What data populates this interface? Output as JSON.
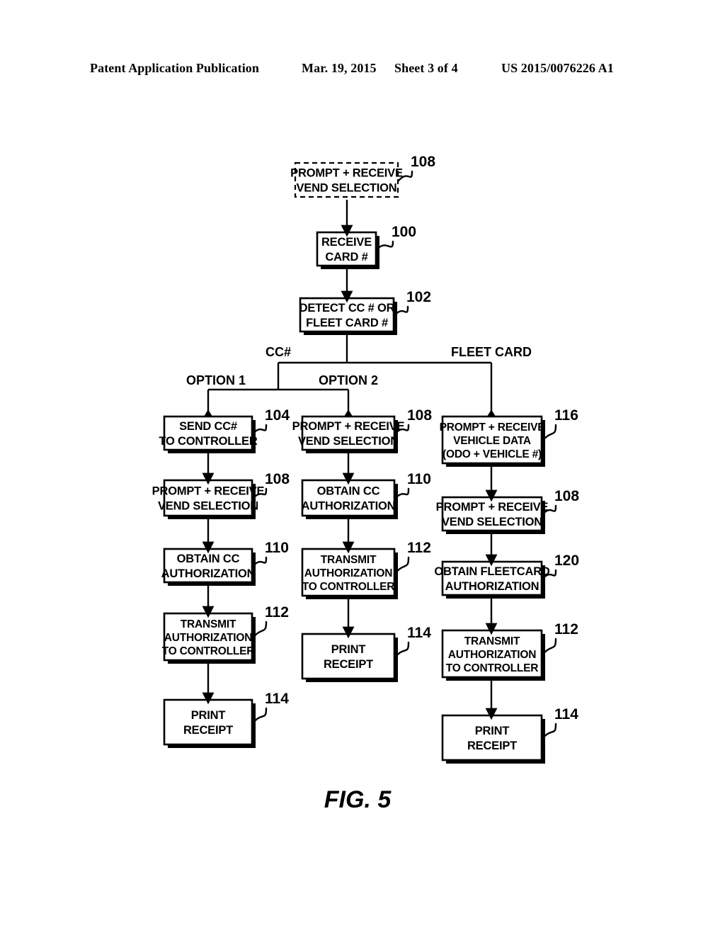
{
  "header": {
    "publication": "Patent Application Publication",
    "date": "Mar. 19, 2015",
    "sheet": "Sheet 3 of 4",
    "patent_number": "US 2015/0076226 A1"
  },
  "figure": {
    "caption": "FIG. 5",
    "caption_label": "FIG.",
    "caption_number": "5"
  },
  "branch_labels": {
    "cc": "CC#",
    "fleet_card": "FLEET CARD",
    "option1": "OPTION 1",
    "option2": "OPTION 2"
  },
  "nodes": {
    "start": {
      "lines": [
        "PROMPT + RECEIVE",
        "VEND SELECTION"
      ],
      "ref": "108",
      "style": "dashed"
    },
    "receive_card": {
      "lines": [
        "RECEIVE",
        "CARD #"
      ],
      "ref": "100",
      "style": "solid"
    },
    "detect": {
      "lines": [
        "DETECT CC # OR",
        "FLEET CARD #"
      ],
      "ref": "102",
      "style": "solid"
    },
    "col1": [
      {
        "lines": [
          "SEND CC#",
          "TO CONTROLLER"
        ],
        "ref": "104"
      },
      {
        "lines": [
          "PROMPT + RECEIVE",
          "VEND SELECTION"
        ],
        "ref": "108"
      },
      {
        "lines": [
          "OBTAIN CC",
          "AUTHORIZATION"
        ],
        "ref": "110"
      },
      {
        "lines": [
          "TRANSMIT",
          "AUTHORIZATION",
          "TO CONTROLLER"
        ],
        "ref": "112"
      },
      {
        "lines": [
          "PRINT",
          "RECEIPT"
        ],
        "ref": "114"
      }
    ],
    "col2": [
      {
        "lines": [
          "PROMPT + RECEIVE",
          "VEND SELECTION"
        ],
        "ref": "108"
      },
      {
        "lines": [
          "OBTAIN CC",
          "AUTHORIZATION"
        ],
        "ref": "110"
      },
      {
        "lines": [
          "TRANSMIT",
          "AUTHORIZATION",
          "TO CONTROLLER"
        ],
        "ref": "112"
      },
      {
        "lines": [
          "PRINT",
          "RECEIPT"
        ],
        "ref": "114"
      }
    ],
    "col3": [
      {
        "lines": [
          "PROMPT + RECEIVE",
          "VEHICLE DATA",
          "(ODO + VEHICLE #)"
        ],
        "ref": "116"
      },
      {
        "lines": [
          "PROMPT + RECEIVE",
          "VEND SELECTION"
        ],
        "ref": "108"
      },
      {
        "lines": [
          "OBTAIN FLEETCARD",
          "AUTHORIZATION"
        ],
        "ref": "120"
      },
      {
        "lines": [
          "TRANSMIT",
          "AUTHORIZATION",
          "TO CONTROLLER"
        ],
        "ref": "112"
      },
      {
        "lines": [
          "PRINT",
          "RECEIPT"
        ],
        "ref": "114"
      }
    ]
  },
  "colors": {
    "ink": "#000000",
    "paper": "#ffffff"
  }
}
